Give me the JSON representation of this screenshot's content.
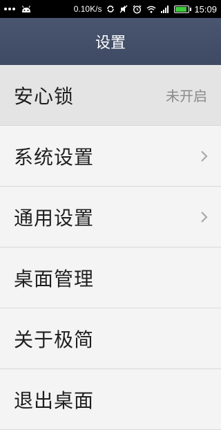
{
  "statusbar": {
    "speed": "0.10K/s",
    "time": "15:09",
    "battery_level": 0.85
  },
  "header": {
    "title": "设置"
  },
  "settings": {
    "items": [
      {
        "label": "安心锁",
        "value": "未开启"
      },
      {
        "label": "系统设置"
      },
      {
        "label": "通用设置"
      },
      {
        "label": "桌面管理"
      },
      {
        "label": "关于极简"
      },
      {
        "label": "退出桌面"
      }
    ]
  },
  "icons": {
    "notification_dots": "more-dots-icon",
    "android": "android-icon",
    "sync": "sync-icon",
    "mute": "mute-icon",
    "alarm": "alarm-icon",
    "wifi": "wifi-icon",
    "signal": "signal-icon",
    "battery": "battery-icon",
    "chevron": "chevron-right-icon"
  }
}
